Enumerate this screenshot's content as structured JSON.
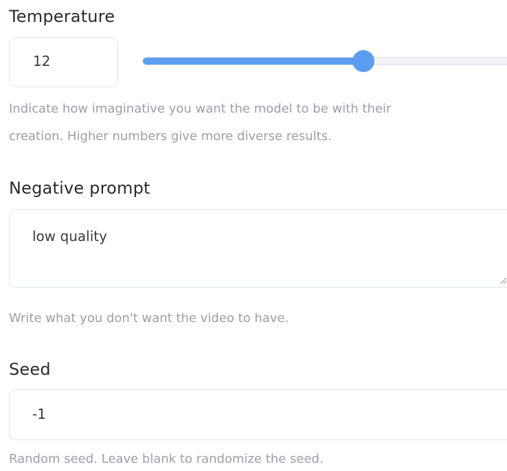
{
  "temperature": {
    "label": "Temperature",
    "value": "12",
    "slider_fraction": 0.575,
    "accent_color": "#5b9df0",
    "hint_line1": "Indicate how imaginative you want the model to be with their",
    "hint_line2": "creation. Higher numbers give more diverse results."
  },
  "negative_prompt": {
    "label": "Negative prompt",
    "value": "low quality",
    "hint": "Write what you don't want the video to have."
  },
  "seed": {
    "label": "Seed",
    "value": "-1",
    "hint": "Random seed. Leave blank to randomize the seed."
  }
}
